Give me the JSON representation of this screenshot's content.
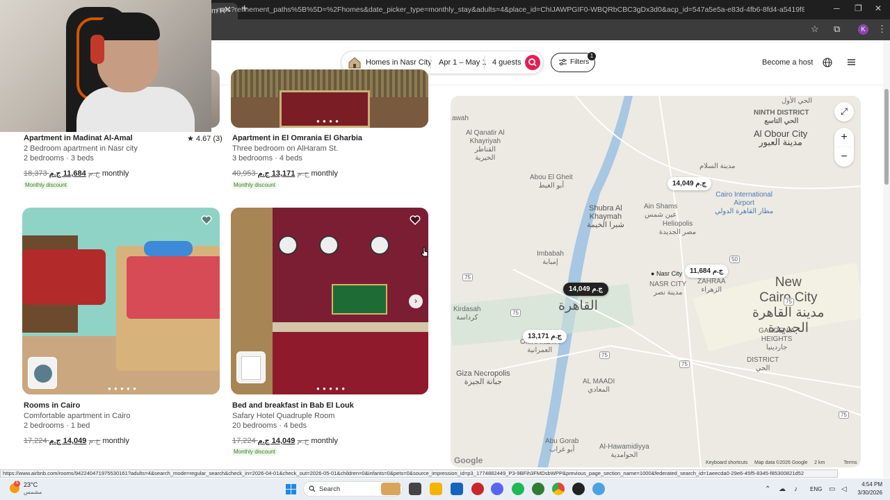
{
  "browser": {
    "tab_title": "m R",
    "url": "mes?refinement_paths%5B%5D=%2Fhomes&date_picker_type=monthly_stay&adults=4&place_id=ChIJAWPGIF0-WBQRbCBC3gDx3d0&acp_id=547a5e5a-e83d-4fb6-8fd4-a5419f8261db&search_type=filter_...",
    "status_url": "https://www.airbnb.com/rooms/942240471975530161?adults=4&search_mode=regular_search&check_in=2026-04-01&check_out=2026-05-01&children=0&infants=0&pets=0&source_impression_id=p3_1774882449_P3-9BFih3FMDsbWPP&previous_page_section_name=1000&federated_search_id=1aeecda0-29e6-45f5-8345-f85300821d52",
    "profile_initial": "K"
  },
  "header": {
    "location": "Homes in Nasr City",
    "dates": "Apr 1 – May 1",
    "guests": "4 guests",
    "filters_label": "Filters",
    "filters_count": "1",
    "become_host": "Become a host"
  },
  "listings": [
    {
      "title": "Apartment in Madinat Al-Amal",
      "rating": "★ 4.67 (3)",
      "subtitle": "2 Bedroom apartment in Nasr city",
      "rooms": "2 bedrooms · 3 beds",
      "old_price": "18,373 ج.م",
      "new_price": "11,684 ج.م",
      "period": "monthly",
      "badge": "Monthly discount"
    },
    {
      "title": "Apartment in El Omrania El Gharbia",
      "subtitle": "Three bedroom on AlHaram St.",
      "rooms": "3 bedrooms · 4 beds",
      "old_price": "40,953 ج.م",
      "new_price": "13,171 ج.م",
      "period": "monthly",
      "badge": "Monthly discount"
    },
    {
      "title": "Rooms in Cairo",
      "subtitle": "Comfortable apartment in Cairo",
      "rooms": "2 bedrooms · 1 bed",
      "old_price": "17,224 ج.م",
      "new_price": "14,049 ج.م",
      "period": "monthly"
    },
    {
      "title": "Bed and breakfast in Bab El Louk",
      "subtitle": "Safary Hotel Quadruple Room",
      "rooms": "20 bedrooms · 4 beds",
      "old_price": "17,224 ج.م",
      "new_price": "14,049 ج.م",
      "period": "monthly",
      "badge": "Monthly discount"
    }
  ],
  "map": {
    "labels": {
      "awah": "awah",
      "al_qanatir": "Al Qanatir Al\nKhayriyah\nالقناطر\nالخيرية",
      "abou_el_gheit": "Abou El Gheit\nأبو الغيط",
      "shubra": "Shubra Al\nKhaymah\nشبرا الخيمة",
      "ain_shams": "Ain Shams\nعين شمس",
      "heliopolis": "Heliopolis\nمصر الجديدة",
      "airport": "Cairo International\nAirport\nمطار القاهرة الدولي",
      "ninth_district": "NINTH DISTRICT\nالحي التاسع",
      "al_obour": "Al Obour City\nمدينة العبور",
      "salam": "مدينة السلام",
      "imbabah": "Imbabah\nإمبابة",
      "nasr_city_ar": "NASR CITY\nمدينة نصر",
      "zahraa": "ZAHRAA\nالزهراء",
      "new_cairo": "New\nCairo City\nمدينة القاهرة\nالجديدة",
      "cairo_ar": "القاهرة",
      "kirdasah": "Kirdasah\nكرداسة",
      "umraneya": "OMRANEYA\nالعمرانية",
      "giza_necropolis": "Giza Necropolis\nجبانة الجيزة",
      "al_maadi": "AL MAADI\nالمعادي",
      "gardenia": "GARDENIA\nHEIGHTS\nجاردينيا",
      "district": "DISTRICT\nالحي",
      "abu_gorab": "Abu Gorab\nأبو غراب",
      "hawamidiya": "Al-Hawamidiyya\nالحوامدية",
      "awal": "الحي الأول"
    },
    "pin_label": "Nasr City",
    "prices": {
      "p1": "14,049 ج.م",
      "p2": "11,684 ج.م",
      "p3": "14,049 ج.م",
      "p4": "13,171 ج.م"
    },
    "shields": [
      "75",
      "50",
      "75",
      "75",
      "75",
      "75",
      "75"
    ],
    "google": "Google",
    "footer": "Keyboard shortcuts     Map data ©2026 Google     2 km              Terms"
  },
  "taskbar": {
    "temp": "23°C",
    "weather": "مشمس",
    "weather_badge": "5",
    "search": "Search",
    "lang": "ENG",
    "time": "4:54 PM",
    "date": "3/30/2026"
  }
}
